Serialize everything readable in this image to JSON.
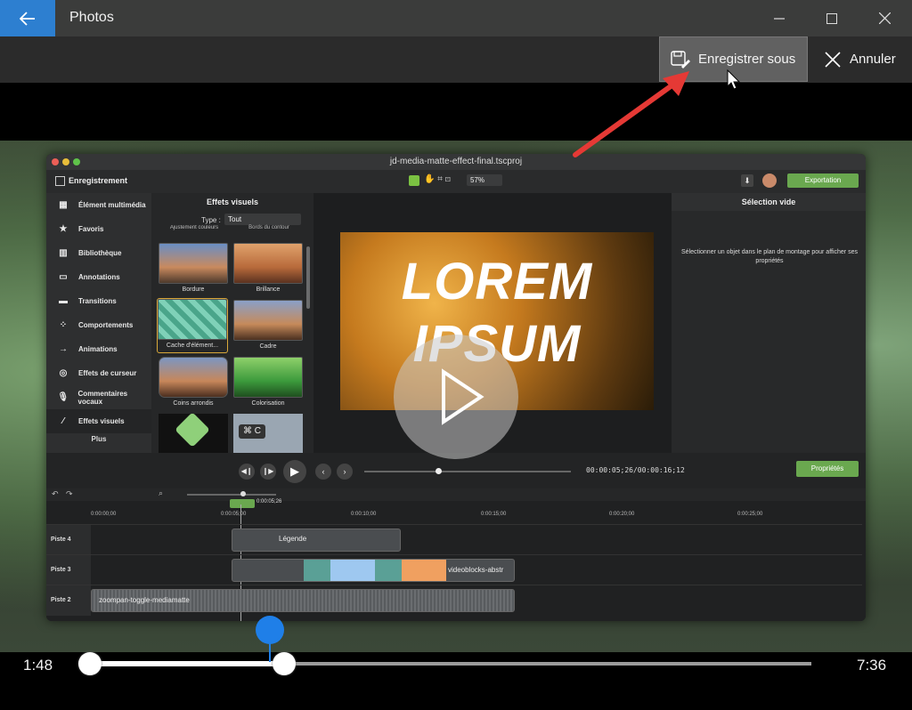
{
  "titlebar": {
    "app_title": "Photos",
    "back_icon": "back-arrow-icon",
    "minimize_icon": "minimize-icon",
    "maximize_icon": "maximize-icon",
    "close_icon": "close-icon",
    "accent": "#2d7fd0"
  },
  "commandbar": {
    "save_label": "Enregistrer sous",
    "save_icon": "save-as-icon",
    "cancel_label": "Annuler",
    "cancel_icon": "close-x-icon"
  },
  "video_frame": {
    "window_title": "jd-media-matte-effect-final.tscproj",
    "record_label": "Enregistrement",
    "zoom_value": "57%",
    "export_label": "Exportation",
    "sidebar": [
      {
        "label": "Élément multimédia",
        "icon": "media-icon"
      },
      {
        "label": "Favoris",
        "icon": "star-icon"
      },
      {
        "label": "Bibliothèque",
        "icon": "library-icon"
      },
      {
        "label": "Annotations",
        "icon": "annotation-icon"
      },
      {
        "label": "Transitions",
        "icon": "transition-icon"
      },
      {
        "label": "Comportements",
        "icon": "behavior-icon"
      },
      {
        "label": "Animations",
        "icon": "animation-icon"
      },
      {
        "label": "Effets de curseur",
        "icon": "cursor-icon"
      },
      {
        "label": "Commentaires vocaux",
        "icon": "mic-icon"
      },
      {
        "label": "Effets visuels",
        "icon": "wand-icon"
      }
    ],
    "sidebar_more": "Plus",
    "effects_panel": {
      "title": "Effets visuels",
      "type_label": "Type :",
      "type_value": "Tout",
      "partial_top_left": "Ajustement couleurs",
      "partial_top_right": "Bords du contour",
      "items": [
        "Bordure",
        "Brillance",
        "Cache d'élément...",
        "Cadre",
        "Coins arrondis",
        "Colorisation"
      ],
      "shortcut_badge": "⌘ C"
    },
    "preview": {
      "line1": "LOREM",
      "line2": "IPSUM"
    },
    "properties_panel": {
      "title": "Sélection vide",
      "message": "Sélectionner un objet dans le plan de montage pour afficher ses propriétés"
    },
    "timecode": "00:00:05;26/00:00:16;12",
    "properties_button": "Propriétés",
    "timeline": {
      "playhead_time": "0:00:05;26",
      "ruler": [
        "0:00:00;00",
        "0:00:05;00",
        "0:00:10;00",
        "0:00:15;00",
        "0:00:20;00",
        "0:00:25;00"
      ],
      "tracks": [
        {
          "label": "Piste 4",
          "clip": "Légende"
        },
        {
          "label": "Piste 3",
          "clip": "videoblocks-abstr"
        },
        {
          "label": "Piste 2",
          "clip": "zoompan-toggle-mediamatte"
        }
      ]
    }
  },
  "scrubber": {
    "start_time": "1:48",
    "end_time": "7:36",
    "playhead_color": "#1f7fe8"
  },
  "annotation": {
    "arrow_color": "#e53935"
  }
}
